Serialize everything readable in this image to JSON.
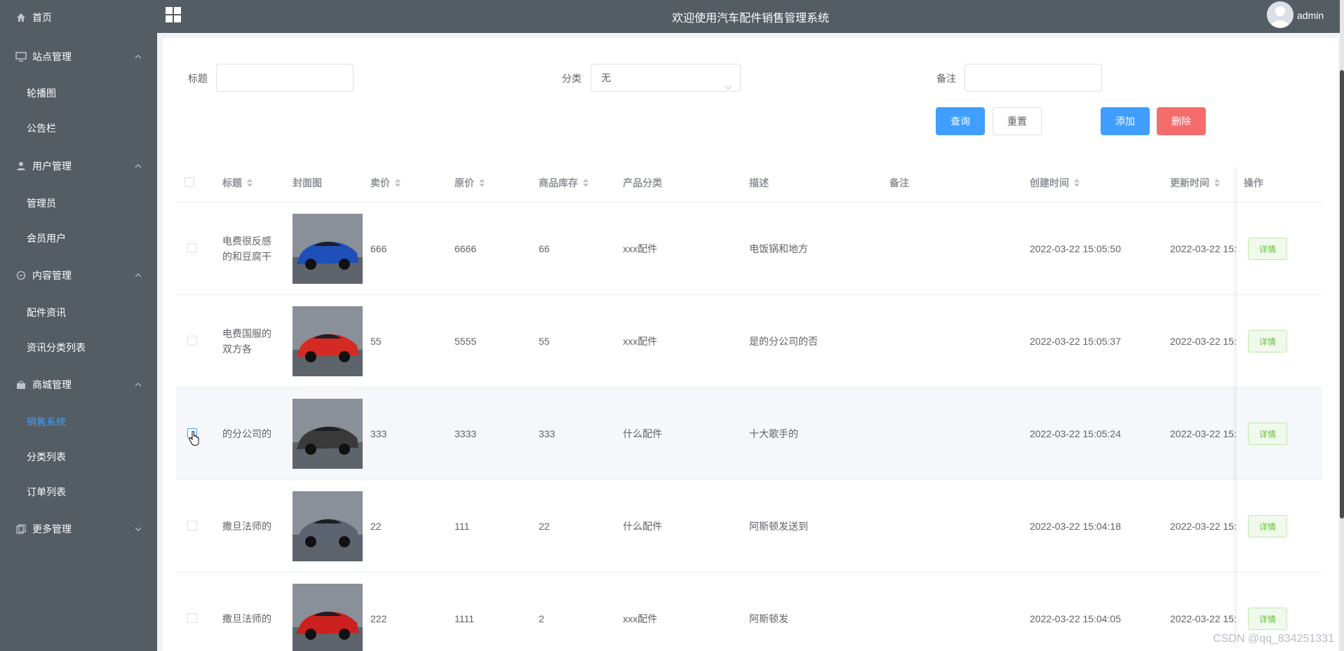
{
  "sidebar": {
    "home": "首页",
    "groups": [
      {
        "label": "站点管理",
        "icon": "monitor-icon",
        "items": [
          "轮播图",
          "公告栏"
        ]
      },
      {
        "label": "用户管理",
        "icon": "user-icon",
        "items": [
          "管理员",
          "会员用户"
        ]
      },
      {
        "label": "内容管理",
        "icon": "chat-icon",
        "items": [
          "配件资讯",
          "资讯分类列表"
        ]
      },
      {
        "label": "商城管理",
        "icon": "bag-icon",
        "items": [
          "销售系统",
          "分类列表",
          "订单列表"
        ]
      },
      {
        "label": "更多管理",
        "icon": "copy-icon",
        "items": []
      }
    ],
    "active_item": "销售系统"
  },
  "header": {
    "title": "欢迎使用汽车配件销售管理系统",
    "username": "admin"
  },
  "search": {
    "title_label": "标题",
    "title_value": "",
    "category_label": "分类",
    "category_value": "无",
    "remark_label": "备注",
    "remark_value": "",
    "query_btn": "查询",
    "reset_btn": "重置",
    "add_btn": "添加",
    "delete_btn": "删除"
  },
  "table": {
    "headers": {
      "title": "标题",
      "cover": "封面图",
      "price": "卖价",
      "original": "原价",
      "stock": "商品库存",
      "category": "产品分类",
      "desc": "描述",
      "remark": "备注",
      "created": "创建时间",
      "updated": "更新时间",
      "action": "操作"
    },
    "detail_label": "详情",
    "rows": [
      {
        "title": "电费很反感的和豆腐干",
        "price": "666",
        "original": "6666",
        "stock": "66",
        "category": "xxx配件",
        "desc": "电饭锅和地方",
        "remark": "",
        "created": "2022-03-22 15:05:50",
        "updated": "2022-03-22 15:",
        "car_color": "#1f4fb8"
      },
      {
        "title": "电费国服的双方各",
        "price": "55",
        "original": "5555",
        "stock": "55",
        "category": "xxx配件",
        "desc": "是的分公司的否",
        "remark": "",
        "created": "2022-03-22 15:05:37",
        "updated": "2022-03-22 15:",
        "car_color": "#d42a24"
      },
      {
        "title": "的分公司的",
        "price": "333",
        "original": "3333",
        "stock": "333",
        "category": "什么配件",
        "desc": "十大歌手的",
        "remark": "",
        "created": "2022-03-22 15:05:24",
        "updated": "2022-03-22 15:",
        "car_color": "#3a3a3a"
      },
      {
        "title": "撒旦法师的",
        "price": "22",
        "original": "111",
        "stock": "22",
        "category": "什么配件",
        "desc": "阿斯顿发送到",
        "remark": "",
        "created": "2022-03-22 15:04:18",
        "updated": "2022-03-22 15:",
        "car_color": "#5b6470"
      },
      {
        "title": "撒旦法师的",
        "price": "222",
        "original": "1111",
        "stock": "2",
        "category": "xxx配件",
        "desc": "阿斯顿发",
        "remark": "",
        "created": "2022-03-22 15:04:05",
        "updated": "2022-03-22 15:",
        "car_color": "#cc1f1f"
      }
    ]
  },
  "watermark": "CSDN @qq_834251331"
}
